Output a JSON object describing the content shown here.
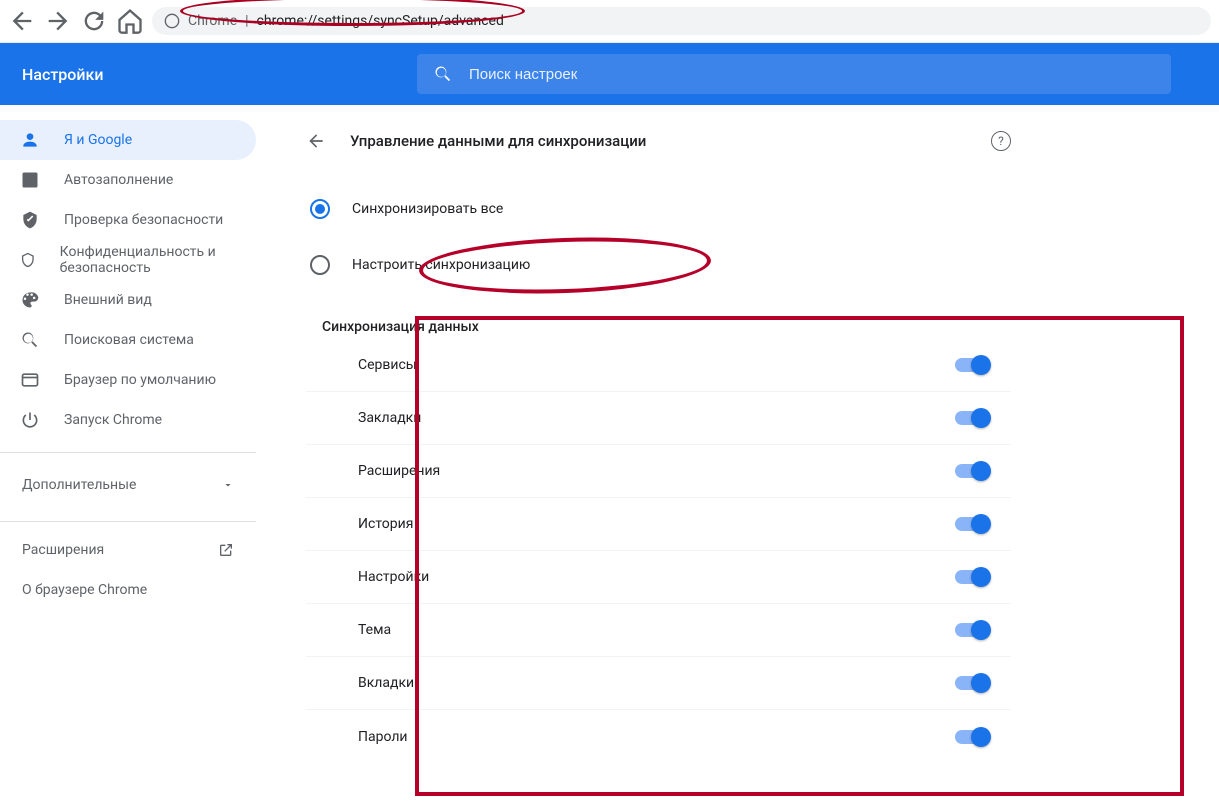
{
  "browser": {
    "url_prefix": "Chrome",
    "url": "chrome://settings/syncSetup/advanced"
  },
  "header": {
    "title": "Настройки",
    "search_placeholder": "Поиск настроек"
  },
  "sidebar": {
    "items": [
      {
        "label": "Я и Google",
        "icon": "person"
      },
      {
        "label": "Автозаполнение",
        "icon": "assignment"
      },
      {
        "label": "Проверка безопасности",
        "icon": "verified"
      },
      {
        "label": "Конфиденциальность и безопасность",
        "icon": "security"
      },
      {
        "label": "Внешний вид",
        "icon": "palette"
      },
      {
        "label": "Поисковая система",
        "icon": "search"
      },
      {
        "label": "Браузер по умолчанию",
        "icon": "web"
      },
      {
        "label": "Запуск Chrome",
        "icon": "power"
      }
    ],
    "advanced": "Дополнительные",
    "extensions": "Расширения",
    "about": "О браузере Chrome"
  },
  "page": {
    "title": "Управление данными для синхронизации",
    "radios": [
      {
        "label": "Синхронизировать все",
        "selected": true
      },
      {
        "label": "Настроить синхронизацию",
        "selected": false
      }
    ],
    "section_title": "Синхронизация данных",
    "toggles": [
      {
        "label": "Сервисы",
        "on": true
      },
      {
        "label": "Закладки",
        "on": true
      },
      {
        "label": "Расширения",
        "on": true
      },
      {
        "label": "История",
        "on": true
      },
      {
        "label": "Настройки",
        "on": true
      },
      {
        "label": "Тема",
        "on": true
      },
      {
        "label": "Вкладки",
        "on": true
      },
      {
        "label": "Пароли",
        "on": true
      }
    ]
  }
}
